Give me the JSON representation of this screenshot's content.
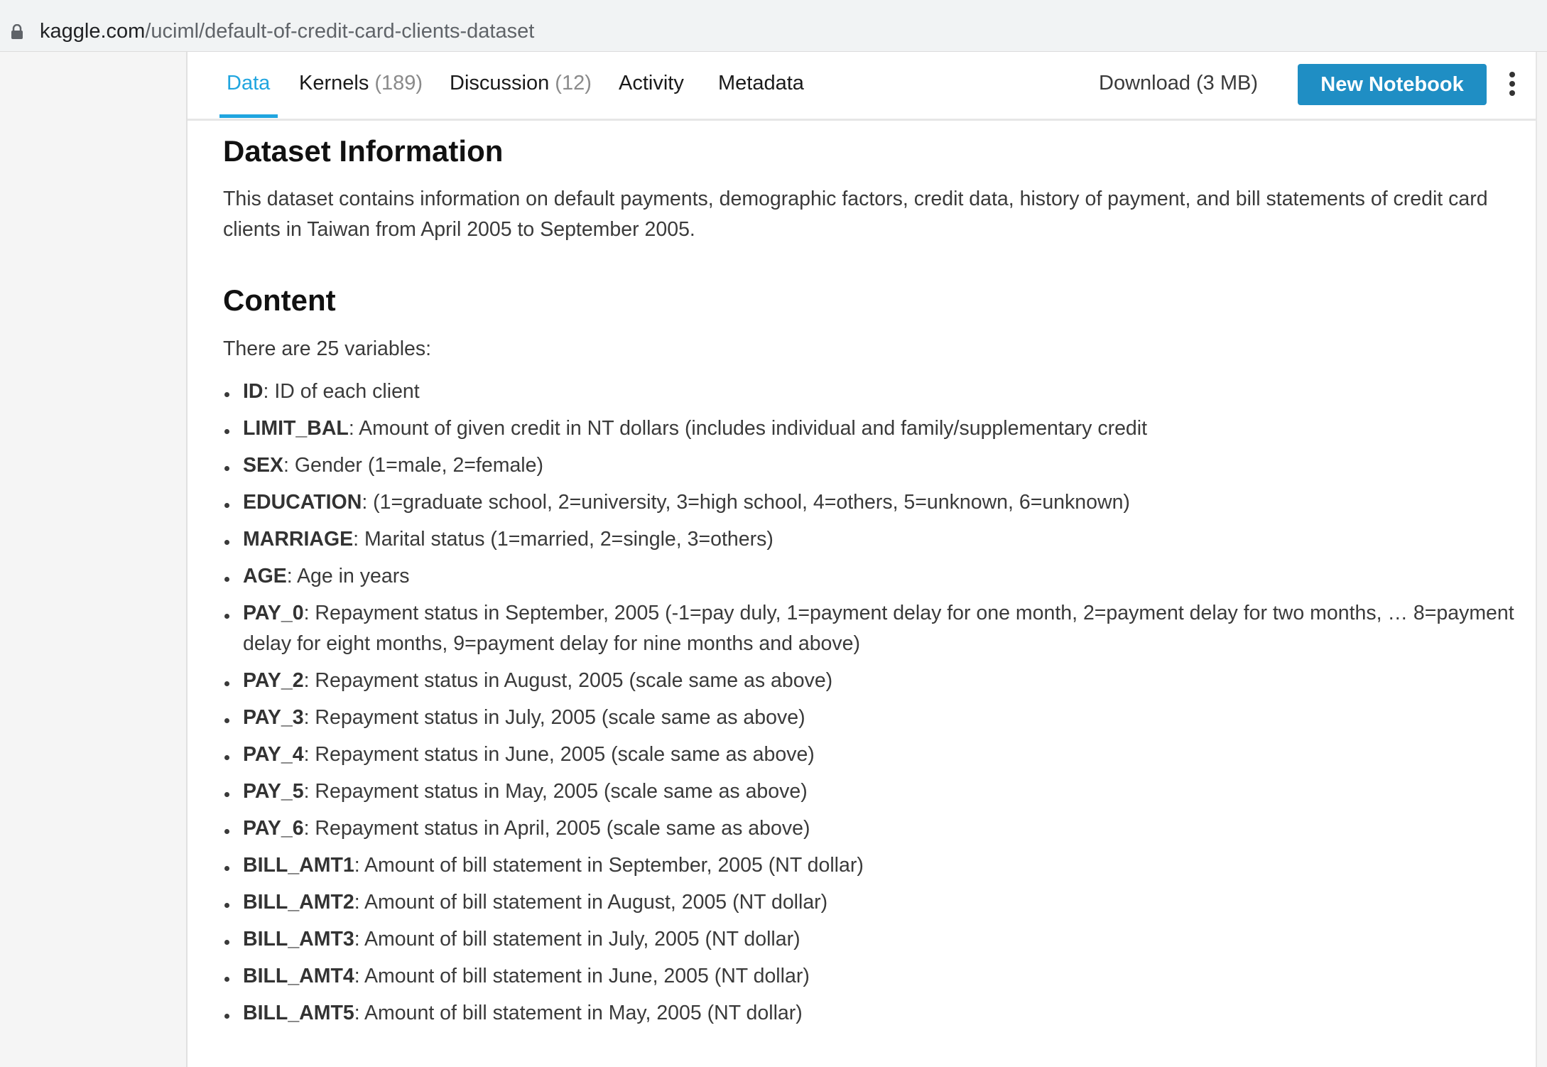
{
  "browser": {
    "url_host": "kaggle.com",
    "url_path": "/uciml/default-of-credit-card-clients-dataset"
  },
  "tabs": [
    {
      "label": "Data",
      "count": ""
    },
    {
      "label": "Kernels",
      "count": "(189)"
    },
    {
      "label": "Discussion",
      "count": "(12)"
    },
    {
      "label": "Activity",
      "count": ""
    },
    {
      "label": "Metadata",
      "count": ""
    }
  ],
  "toolbar": {
    "download_label": "Download (3 MB)",
    "new_notebook_label": "New Notebook"
  },
  "section1": {
    "title": "Dataset Information",
    "text": "This dataset contains information on default payments, demographic factors, credit data, history of payment, and bill statements of credit card clients in Taiwan from April 2005 to September 2005."
  },
  "section2": {
    "title": "Content",
    "intro": "There are 25 variables:",
    "variables": [
      {
        "name": "ID",
        "desc": ": ID of each client"
      },
      {
        "name": "LIMIT_BAL",
        "desc": ": Amount of given credit in NT dollars (includes individual and family/supplementary credit"
      },
      {
        "name": "SEX",
        "desc": ": Gender (1=male, 2=female)"
      },
      {
        "name": "EDUCATION",
        "desc": ": (1=graduate school, 2=university, 3=high school, 4=others, 5=unknown, 6=unknown)"
      },
      {
        "name": "MARRIAGE",
        "desc": ": Marital status (1=married, 2=single, 3=others)"
      },
      {
        "name": "AGE",
        "desc": ": Age in years"
      },
      {
        "name": "PAY_0",
        "desc": ": Repayment status in September, 2005 (-1=pay duly, 1=payment delay for one month, 2=payment delay for two months, … 8=payment delay for eight months, 9=payment delay for nine months and above)"
      },
      {
        "name": "PAY_2",
        "desc": ": Repayment status in August, 2005 (scale same as above)"
      },
      {
        "name": "PAY_3",
        "desc": ": Repayment status in July, 2005 (scale same as above)"
      },
      {
        "name": "PAY_4",
        "desc": ": Repayment status in June, 2005 (scale same as above)"
      },
      {
        "name": "PAY_5",
        "desc": ": Repayment status in May, 2005 (scale same as above)"
      },
      {
        "name": "PAY_6",
        "desc": ": Repayment status in April, 2005 (scale same as above)"
      },
      {
        "name": "BILL_AMT1",
        "desc": ": Amount of bill statement in September, 2005 (NT dollar)"
      },
      {
        "name": "BILL_AMT2",
        "desc": ": Amount of bill statement in August, 2005 (NT dollar)"
      },
      {
        "name": "BILL_AMT3",
        "desc": ": Amount of bill statement in July, 2005 (NT dollar)"
      },
      {
        "name": "BILL_AMT4",
        "desc": ": Amount of bill statement in June, 2005 (NT dollar)"
      },
      {
        "name": "BILL_AMT5",
        "desc": ": Amount of bill statement in May, 2005 (NT dollar)"
      }
    ]
  }
}
